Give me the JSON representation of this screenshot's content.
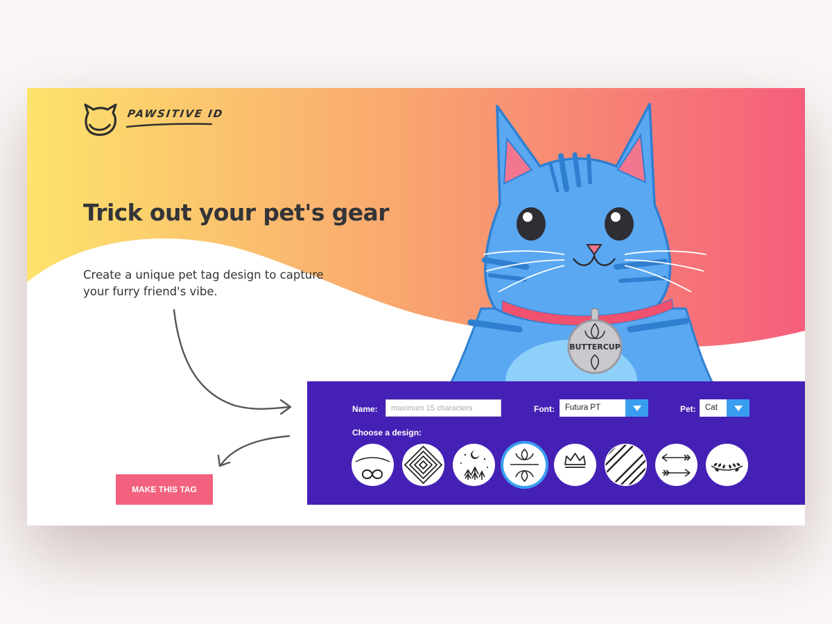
{
  "brand": {
    "name": "PAWSITIVE ID",
    "logo_icon": "cat-head-logo-icon"
  },
  "hero": {
    "headline": "Trick out your pet's gear",
    "subtitle": "Create a unique pet tag design to capture your furry friend's vibe."
  },
  "illustration": {
    "subject": "cat-illustration",
    "tag_text": "BUTTERCUP"
  },
  "form": {
    "name_label": "Name:",
    "name_value": "",
    "name_placeholder": "maximum 15 characters",
    "font_label": "Font:",
    "font_value": "Futura PT",
    "pet_label": "Pet:",
    "pet_value": "Cat",
    "design_label": "Choose a design:",
    "designs": [
      {
        "icon": "infinity-icon",
        "selected": false
      },
      {
        "icon": "nested-diamonds-icon",
        "selected": false
      },
      {
        "icon": "night-forest-icon",
        "selected": false
      },
      {
        "icon": "lotus-icon",
        "selected": true
      },
      {
        "icon": "crown-icon",
        "selected": false
      },
      {
        "icon": "diagonal-stripes-icon",
        "selected": false
      },
      {
        "icon": "arrows-icon",
        "selected": false
      },
      {
        "icon": "laurel-icon",
        "selected": false
      }
    ]
  },
  "cta": {
    "label": "MAKE THIS TAG"
  },
  "colors": {
    "gradient_start": "#fde36c",
    "gradient_mid": "#f9a46f",
    "gradient_end": "#f55e7c",
    "panel": "#4520b5",
    "accent": "#3a9ef0",
    "cta": "#f2617d",
    "cat": "#5aa8f2"
  }
}
